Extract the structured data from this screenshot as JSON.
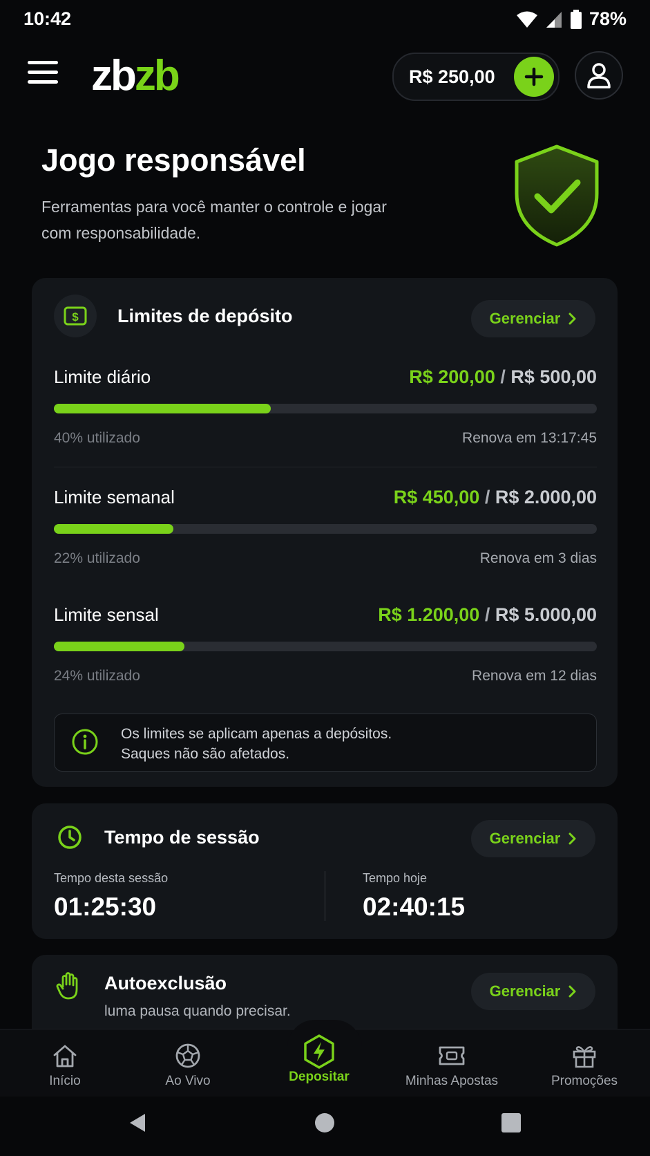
{
  "status_bar": {
    "time": "10:42",
    "battery": "78%"
  },
  "header": {
    "logo_part1": "zb",
    "logo_part2": "zb",
    "balance": "R$ 250,00",
    "brand_color": "#7ad21a"
  },
  "page": {
    "title": "Jogo responsável",
    "subtitle": "Ferramentas para você manter o controle e jogar com responsabilidade."
  },
  "deposit_limits": {
    "title": "Limites de depósito",
    "manage_label": "Gerenciar",
    "limits": [
      {
        "label": "Limite diário",
        "used": "R$ 200,00",
        "separator": "/",
        "max": "R$ 500,00",
        "percent": 40,
        "used_text": "40% utilizado",
        "renew_text": "Renova em 13:17:45"
      },
      {
        "label": "Limite semanal",
        "used": "R$ 450,00",
        "separator": "/",
        "max": "R$ 2.000,00",
        "percent": 22,
        "used_text": "22% utilizado",
        "renew_text": "Renova em 3 dias"
      },
      {
        "label": "Limite sensal",
        "used": "R$ 1.200,00",
        "separator": "/",
        "max": "R$ 5.000,00",
        "percent": 24,
        "used_text": "24% utilizado",
        "renew_text": "Renova em 12 dias"
      }
    ],
    "info_line1": "Os limites se aplicam apenas a depósitos.",
    "info_line2": "Saques não são afetados."
  },
  "session_time": {
    "title": "Tempo de sessão",
    "manage_label": "Gerenciar",
    "current_label": "Tempo desta sessão",
    "current_value": "01:25:30",
    "today_label": "Tempo hoje",
    "today_value": "02:40:15"
  },
  "self_exclusion": {
    "title": "Autoexclusão",
    "subtitle": "luma pausa quando precisar.",
    "manage_label": "Gerenciar"
  },
  "bottom_nav": {
    "items": [
      {
        "label": "Início",
        "icon": "home-icon"
      },
      {
        "label": "Ao Vivo",
        "icon": "soccer-ball-icon"
      },
      {
        "label": "Depositar",
        "icon": "lightning-hex-icon",
        "active": true
      },
      {
        "label": "Minhas Apostas",
        "icon": "ticket-icon"
      },
      {
        "label": "Promoções",
        "icon": "gift-icon"
      }
    ]
  }
}
